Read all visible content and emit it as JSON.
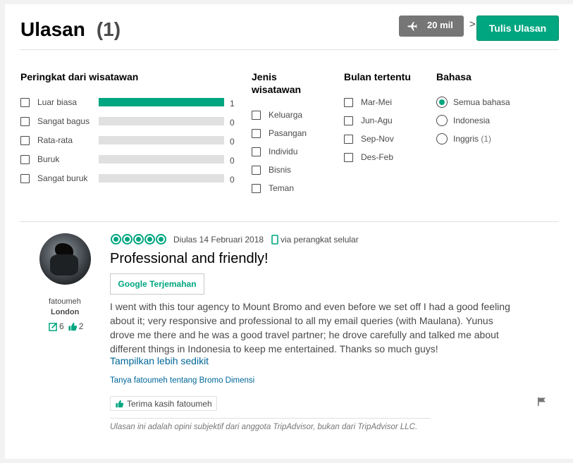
{
  "header": {
    "title": "Ulasan",
    "count": "(1)",
    "distance": "20 mil",
    "chevron": ">",
    "write_review": "Tulis Ulasan"
  },
  "filters": {
    "rating": {
      "heading": "Peringkat dari wisatawan",
      "items": [
        {
          "label": "Luar biasa",
          "count": "1",
          "fraction": 1.0
        },
        {
          "label": "Sangat bagus",
          "count": "0",
          "fraction": 0
        },
        {
          "label": "Rata-rata",
          "count": "0",
          "fraction": 0
        },
        {
          "label": "Buruk",
          "count": "0",
          "fraction": 0
        },
        {
          "label": "Sangat buruk",
          "count": "0",
          "fraction": 0
        }
      ]
    },
    "traveler_type": {
      "heading_line1": "Jenis",
      "heading_line2": "wisatawan",
      "items": [
        "Keluarga",
        "Pasangan",
        "Individu",
        "Bisnis",
        "Teman"
      ]
    },
    "month": {
      "heading": "Bulan tertentu",
      "items": [
        "Mar-Mei",
        "Jun-Agu",
        "Sep-Nov",
        "Des-Feb"
      ]
    },
    "language": {
      "heading": "Bahasa",
      "items": [
        {
          "label": "Semua bahasa",
          "selected": true,
          "extra": ""
        },
        {
          "label": "Indonesia",
          "selected": false,
          "extra": ""
        },
        {
          "label": "Inggris",
          "selected": false,
          "extra": "(1)"
        }
      ]
    }
  },
  "review": {
    "user_name": "fatoumeh",
    "user_location": "London",
    "contributions": "6",
    "helpful_votes": "2",
    "rating": 5,
    "date": "Diulas 14 Februari 2018",
    "device": "via perangkat selular",
    "title": "Professional and friendly!",
    "translate_button": "Google Terjemahan",
    "text": "I went with this tour agency to Mount Bromo and even before we set off I had a good feeling about it; very responsive and professional to all my email queries (with Maulana). Yunus drove me there and he was a good travel partner; he drove carefully and talked me about different things in Indonesia to keep me entertained. Thanks so much guys!",
    "show_less": "Tampilkan lebih sedikit",
    "ask_link": "Tanya fatoumeh tentang Bromo Dimensi",
    "thank_button": "Terima kasih fatoumeh",
    "disclaimer": "Ulasan ini adalah opini subjektif dari anggota TripAdvisor, bukan dari TripAdvisor LLC."
  },
  "colors": {
    "accent": "#00a680",
    "link": "#006699",
    "badge": "#767676"
  }
}
